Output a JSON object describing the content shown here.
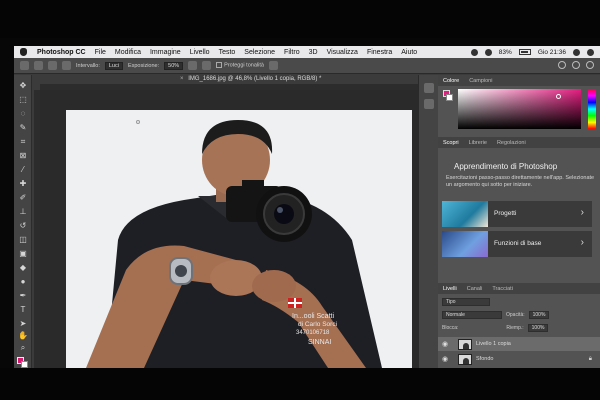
{
  "menubar": {
    "items": [
      "Photoshop CC",
      "File",
      "Modifica",
      "Immagine",
      "Livello",
      "Testo",
      "Selezione",
      "Filtro",
      "3D",
      "Visualizza",
      "Finestra",
      "Aiuto"
    ],
    "battery": "83%",
    "clock": "Gio 21:36"
  },
  "options_bar": {
    "interval_label": "Intervallo:",
    "interval_value": "Luci",
    "exposure_label": "Esposizione:",
    "exposure_value": "50%",
    "protect_label": "Proteggi tonalità"
  },
  "document": {
    "tab_title": "IMG_1686.jpg @ 46,8% (Livello 1 copia, RGB/8) *"
  },
  "color_panel": {
    "tabs": [
      "Colore",
      "Campioni"
    ],
    "foreground": "#e41d80",
    "background": "#ffffff"
  },
  "learn_panel": {
    "tabs": [
      "Scopri",
      "Librerie",
      "Regolazioni"
    ],
    "title": "Apprendimento di Photoshop",
    "description": "Esercitazioni passo-passo direttamente nell'app. Selezionate un argomento qui sotto per iniziare.",
    "cards": [
      {
        "label": "Progetti"
      },
      {
        "label": "Funzioni di base"
      }
    ]
  },
  "layers_panel": {
    "tabs": [
      "Livelli",
      "Canali",
      "Tracciati"
    ],
    "filter_value": "Tipo",
    "blend_mode": "Normale",
    "opacity_label": "Opacità:",
    "opacity_value": "100%",
    "lock_label": "Blocca:",
    "fill_label": "Riemp.:",
    "fill_value": "100%",
    "layers": [
      {
        "name": "Livello 1 copia",
        "selected": true
      },
      {
        "name": "Sfondo",
        "selected": false
      }
    ]
  },
  "photo": {
    "shirt_text_lines": [
      "In...ooli Scatti",
      "di Carlo Sorci",
      "3470106718",
      "SINNAI"
    ]
  }
}
